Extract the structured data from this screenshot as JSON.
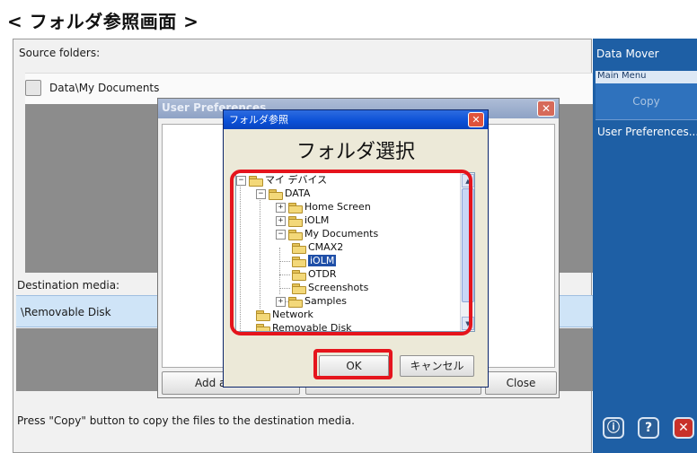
{
  "page_heading": "< フォルダ参照画面 >",
  "main": {
    "source_label": "Source folders:",
    "source_items": [
      "Data\\My Documents"
    ],
    "destination_label": "Destination media:",
    "destination_items": [
      "\\Removable Disk"
    ],
    "add_button": "Add a",
    "close_button": "Close",
    "status_text": "Press \"Copy\" button to copy the files to the destination media."
  },
  "user_prefs_dialog": {
    "title": "User Preferences",
    "close_glyph": "✕"
  },
  "folder_dialog": {
    "title": "フォルダ参照",
    "close_glyph": "✕",
    "heading": "フォルダ選択",
    "tree": [
      {
        "label": "マイ デバイス",
        "expander": "−"
      },
      {
        "label": "DATA",
        "expander": "−"
      },
      {
        "label": "Home Screen",
        "expander": "+"
      },
      {
        "label": "iOLM",
        "expander": "+"
      },
      {
        "label": "My Documents",
        "expander": "−"
      },
      {
        "label": "CMAX2",
        "expander": ""
      },
      {
        "label": "iOLM",
        "expander": "",
        "selected": true
      },
      {
        "label": "OTDR",
        "expander": ""
      },
      {
        "label": "Screenshots",
        "expander": ""
      },
      {
        "label": "Samples",
        "expander": "+"
      },
      {
        "label": "Network",
        "expander": ""
      },
      {
        "label": "Removable Disk",
        "expander": ""
      }
    ],
    "ok_button": "OK",
    "cancel_button": "キャンセル"
  },
  "side_panel": {
    "title": "Data Mover",
    "menu_label": "Main Menu",
    "copy_label": "Copy",
    "prefs_label": "User Preferences...",
    "info_glyph": "ⓘ",
    "help_glyph": "?",
    "exit_glyph": "✕"
  },
  "colors": {
    "highlight_red": "#e5141c",
    "side_panel_blue": "#1e5fa5",
    "xp_titlebar_blue": "#0a4fd6",
    "selection_blue": "#1f4fa8"
  }
}
